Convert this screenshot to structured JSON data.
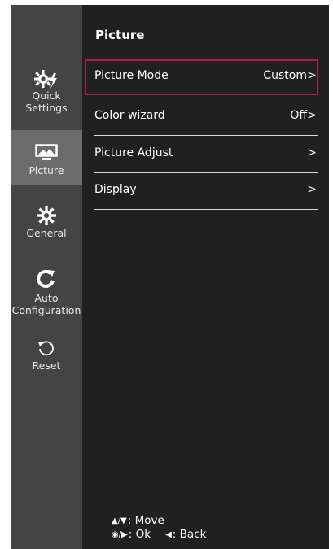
{
  "header": {
    "title": "Picture"
  },
  "sidebar": {
    "items": [
      {
        "label": "Quick Settings",
        "icon": "quick-settings-icon",
        "active": false
      },
      {
        "label": "Picture",
        "icon": "picture-icon",
        "active": true
      },
      {
        "label": "General",
        "icon": "gear-icon",
        "active": false
      },
      {
        "label": "Auto Configuration",
        "icon": "auto-config-icon",
        "active": false
      },
      {
        "label": "Reset",
        "icon": "reset-icon",
        "active": false
      }
    ]
  },
  "menu": {
    "rows": [
      {
        "label": "Picture Mode",
        "value": "Custom",
        "selected": true
      },
      {
        "label": "Color wizard",
        "value": "Off",
        "selected": false
      },
      {
        "label": "Picture Adjust",
        "value": "",
        "selected": false
      },
      {
        "label": "Display",
        "value": "",
        "selected": false
      }
    ],
    "chevron": ">"
  },
  "footer": {
    "move_label": ": Move",
    "ok_label": ": Ok",
    "back_label": ": Back"
  },
  "colors": {
    "panel": "#202020",
    "sidebar": "#444444",
    "sidebar_active": "#6c6c6c",
    "selection_border": "#b01e4e"
  }
}
